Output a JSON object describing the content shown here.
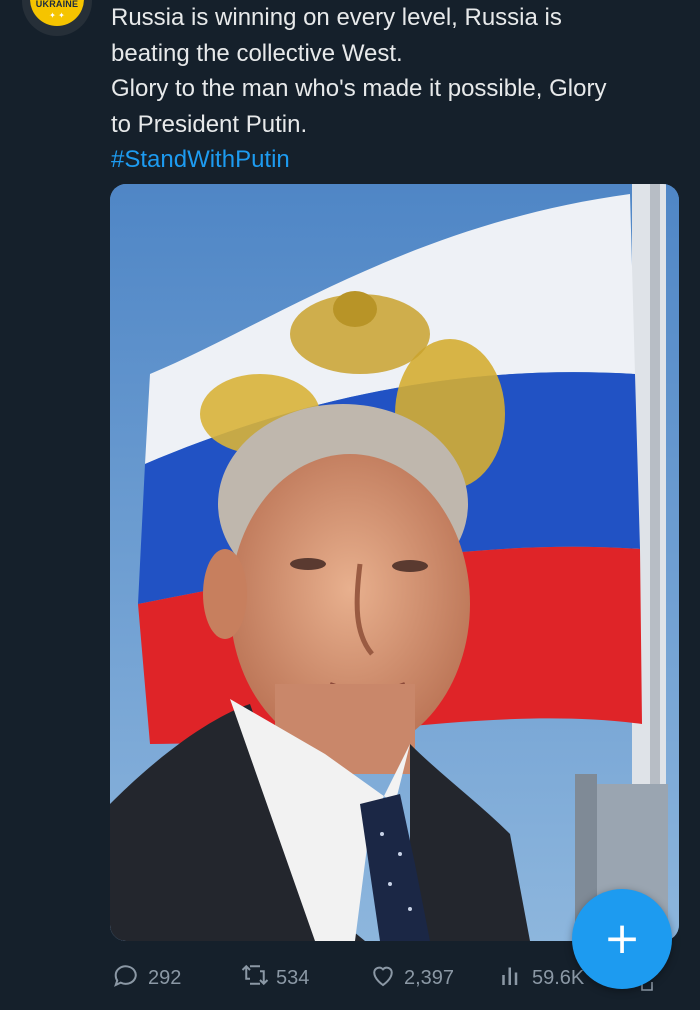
{
  "avatar": {
    "badge_text": "UKRAINE",
    "badge_marks": "✦ ✦",
    "icon": "ukraine-badge-icon"
  },
  "tweet": {
    "lines": [
      "Russia is winning on every level, Russia is",
      "beating the collective West.",
      "Glory to the man who's made it possible, Glory",
      "to President Putin."
    ],
    "hashtag": "#StandWithPutin"
  },
  "media": {
    "description_icon": "photo",
    "colors": {
      "sky": "#5d8fc9",
      "flag_white": "#e9eef5",
      "flag_blue": "#1f56c9",
      "flag_red": "#e0262a",
      "suit": "#24272e"
    }
  },
  "actions": {
    "reply": {
      "count": "292",
      "icon": "reply-bubble-icon"
    },
    "retweet": {
      "count": "534",
      "icon": "retweet-arrows-icon"
    },
    "like": {
      "count": "2,397",
      "icon": "heart-icon"
    },
    "views": {
      "count": "59.6K",
      "icon": "bar-chart-icon"
    }
  },
  "fab": {
    "label": "+",
    "icon": "compose-plus-icon",
    "color": "#1d9bf0"
  }
}
